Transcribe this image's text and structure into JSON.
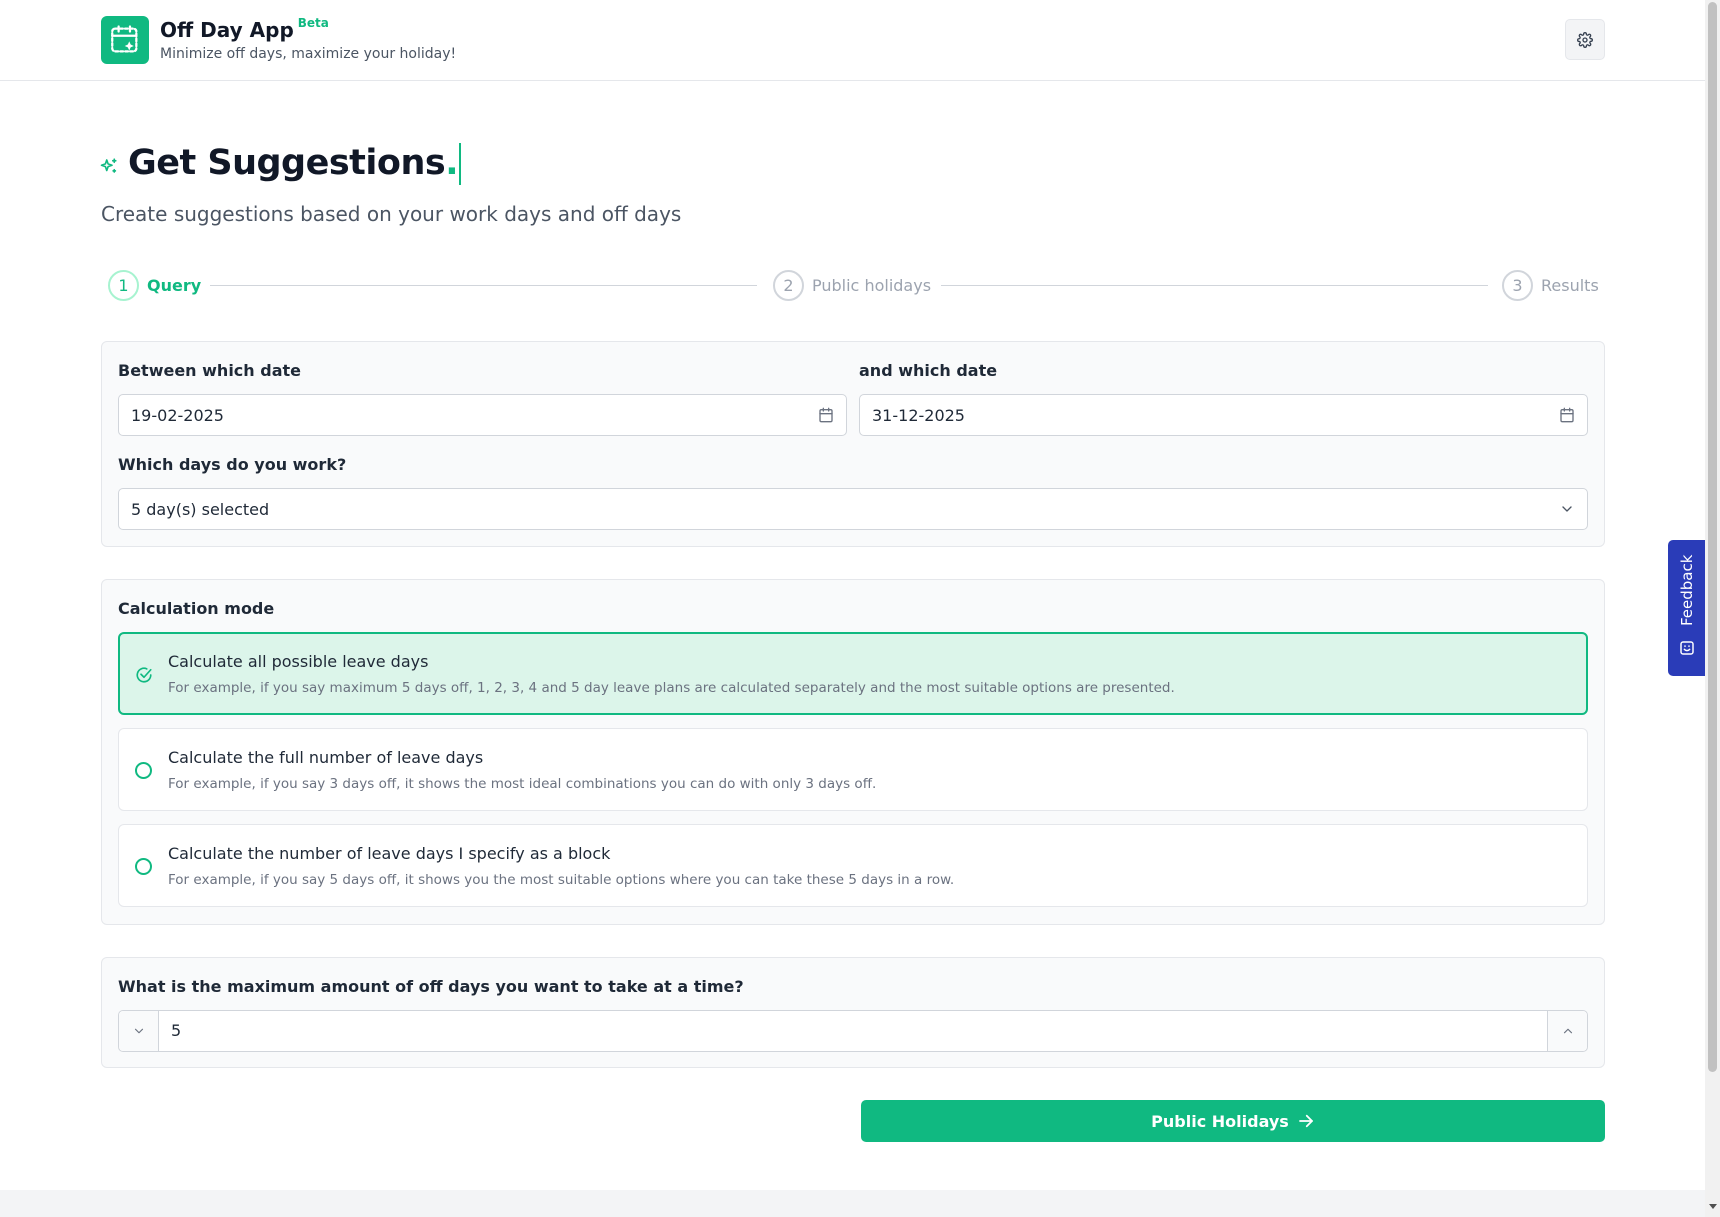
{
  "header": {
    "app_name": "Off Day App",
    "badge": "Beta",
    "tagline": "Minimize off days, maximize your holiday!",
    "settings_icon": "gear-icon"
  },
  "page": {
    "title": "Get Suggestions",
    "title_suffix": ".",
    "subtitle": "Create suggestions based on your work days and off days"
  },
  "steps": [
    {
      "number": "1",
      "label": "Query",
      "active": true
    },
    {
      "number": "2",
      "label": "Public holidays",
      "active": false
    },
    {
      "number": "3",
      "label": "Results",
      "active": false
    }
  ],
  "query": {
    "start_label": "Between which date",
    "start_value": "19-02-2025",
    "end_label": "and which date",
    "end_value": "31-12-2025",
    "workdays_label": "Which days do you work?",
    "workdays_value": "5 day(s) selected"
  },
  "calculation": {
    "label": "Calculation mode",
    "options": [
      {
        "title": "Calculate all possible leave days",
        "desc": "For example, if you say maximum 5 days off, 1, 2, 3, 4 and 5 day leave plans are calculated separately and the most suitable options are presented.",
        "selected": true
      },
      {
        "title": "Calculate the full number of leave days",
        "desc": "For example, if you say 3 days off, it shows the most ideal combinations you can do with only 3 days off.",
        "selected": false
      },
      {
        "title": "Calculate the number of leave days I specify as a block",
        "desc": "For example, if you say 5 days off, it shows you the most suitable options where you can take these 5 days in a row.",
        "selected": false
      }
    ]
  },
  "max_days": {
    "label": "What is the maximum amount of off days you want to take at a time?",
    "value": "5"
  },
  "actions": {
    "next_label": "Public Holidays"
  },
  "feedback": {
    "label": "Feedback"
  },
  "colors": {
    "accent": "#10b981",
    "selected_bg": "#dcf5ea",
    "feedback": "#2a3cb8"
  }
}
